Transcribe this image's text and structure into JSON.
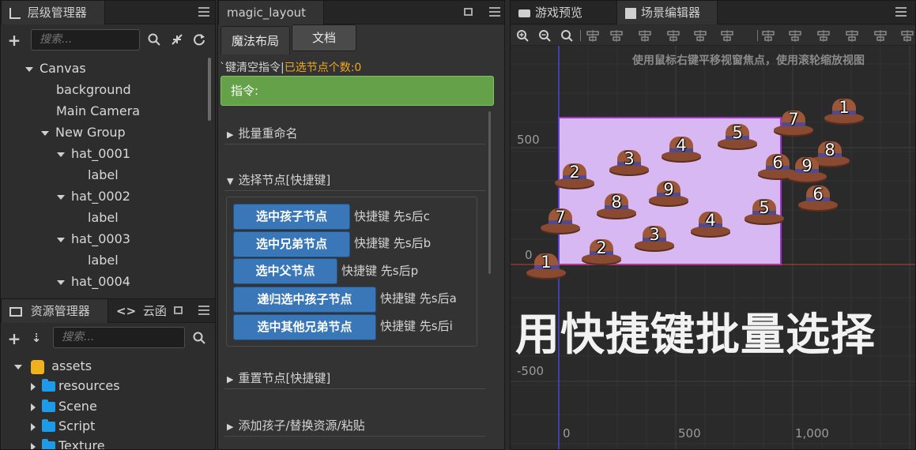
{
  "hierarchy": {
    "title": "层级管理器",
    "search_placeholder": "搜索...",
    "items": [
      {
        "label": "Canvas",
        "expanded": true
      },
      {
        "label": "background"
      },
      {
        "label": "Main Camera"
      },
      {
        "label": "New Group",
        "expanded": true
      },
      {
        "label": "hat_0001",
        "expanded": true
      },
      {
        "label": "label"
      },
      {
        "label": "hat_0002",
        "expanded": true
      },
      {
        "label": "label"
      },
      {
        "label": "hat_0003",
        "expanded": true
      },
      {
        "label": "label"
      },
      {
        "label": "hat_0004",
        "expanded": true
      }
    ]
  },
  "assets": {
    "title": "资源管理器",
    "tab2": "云函",
    "search_placeholder": "搜索...",
    "root": "assets",
    "folders": [
      "resources",
      "Scene",
      "Script",
      "Texture"
    ]
  },
  "magic": {
    "tab": "magic_layout",
    "tab_magic": "魔法布局",
    "tab_docs": "文档",
    "status_prefix": "`键清空指令|",
    "status_selected": "已选节点个数:0",
    "command_label": "指令:",
    "sections": {
      "rename": "批量重命名",
      "select": "选择节点[快捷键]",
      "reset": "重置节点[快捷键]",
      "add": "添加孩子/替换资源/粘贴"
    },
    "buttons": [
      {
        "label": "选中孩子节点",
        "hint": "快捷键 先s后c"
      },
      {
        "label": "选中兄弟节点",
        "hint": "快捷键 先s后b"
      },
      {
        "label": "选中父节点",
        "hint": "快捷键 先s后p"
      },
      {
        "label": "递归选中孩子节点",
        "hint": "快捷键 先s后a"
      },
      {
        "label": "选中其他兄弟节点",
        "hint": "快捷键 先s后i"
      }
    ]
  },
  "scene": {
    "tab_preview": "游戏预览",
    "tab_editor": "场景编辑器",
    "hint": "使用鼠标右键平移视窗焦点，使用滚轮缩放视图",
    "overlay_text": "用快捷键批量选择",
    "y_labels": [
      "500",
      "0",
      "-500"
    ],
    "x_labels": [
      "0",
      "500",
      "1,000"
    ],
    "hats": [
      "1",
      "2",
      "3",
      "4",
      "5",
      "6",
      "7",
      "8",
      "9",
      "2",
      "3",
      "4",
      "5",
      "6",
      "7",
      "8",
      "9",
      "1"
    ],
    "colors": {
      "canvas_fill": "#d8b8f2",
      "canvas_border": "#a333d0"
    }
  }
}
